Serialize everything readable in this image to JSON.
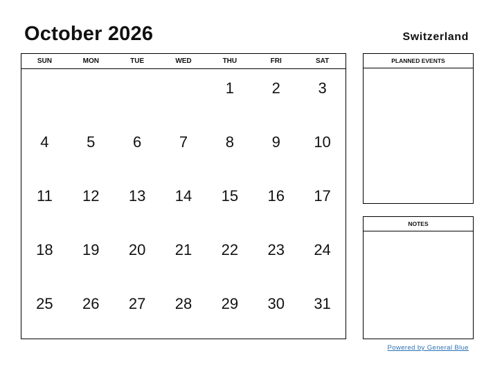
{
  "header": {
    "title": "October 2026",
    "country": "Switzerland"
  },
  "calendar": {
    "weekdays": [
      "SUN",
      "MON",
      "TUE",
      "WED",
      "THU",
      "FRI",
      "SAT"
    ],
    "cells": [
      "",
      "",
      "",
      "",
      "1",
      "2",
      "3",
      "4",
      "5",
      "6",
      "7",
      "8",
      "9",
      "10",
      "11",
      "12",
      "13",
      "14",
      "15",
      "16",
      "17",
      "18",
      "19",
      "20",
      "21",
      "22",
      "23",
      "24",
      "25",
      "26",
      "27",
      "28",
      "29",
      "30",
      "31"
    ]
  },
  "panels": {
    "planned_events": "PLANNED EVENTS",
    "notes": "NOTES"
  },
  "footer": {
    "link": "Powered by General Blue",
    "link_color": "#2a6fb3"
  }
}
